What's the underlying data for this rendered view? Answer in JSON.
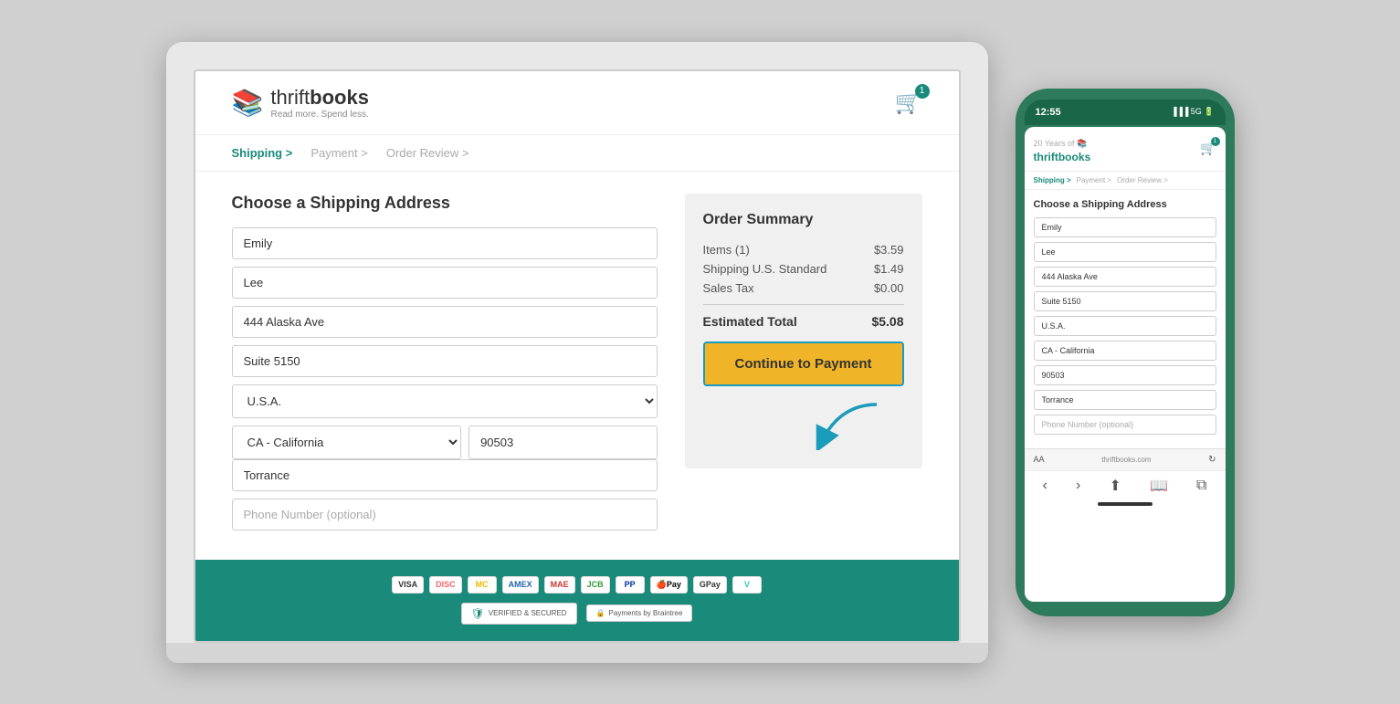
{
  "site": {
    "logo_text_light": "thrift",
    "logo_text_bold": "books",
    "logo_tagline": "Read more. Spend less.",
    "logo_icon": "📚"
  },
  "header": {
    "cart_count": "1"
  },
  "breadcrumbs": [
    {
      "label": "Shipping >",
      "active": true
    },
    {
      "label": "Payment >",
      "active": false
    },
    {
      "label": "Order Review >",
      "active": false
    }
  ],
  "shipping_form": {
    "title": "Choose a Shipping Address",
    "fields": {
      "first_name": "Emily",
      "last_name": "Lee",
      "address": "444 Alaska Ave",
      "suite": "Suite 5150",
      "country": "U.S.A.",
      "state": "CA - California",
      "zip": "90503",
      "city": "Torrance",
      "phone_placeholder": "Phone Number (optional)"
    }
  },
  "order_summary": {
    "title": "Order Summary",
    "items_label": "Items (1)",
    "items_price": "$3.59",
    "shipping_label": "Shipping U.S. Standard",
    "shipping_price": "$1.49",
    "tax_label": "Sales Tax",
    "tax_price": "$0.00",
    "total_label": "Estimated Total",
    "total_price": "$5.08",
    "cta_label": "Continue to Payment"
  },
  "payment_icons": [
    "VISA",
    "DISC",
    "MC",
    "AMEX",
    "MAE",
    "JCB",
    "PP",
    "ApplePay",
    "GPay",
    "Venmo"
  ],
  "security": {
    "verified": "VERIFIED & SECURED",
    "braintree": "Payments by Braintree"
  },
  "mobile": {
    "time": "12:55",
    "status": "📶 5G🔋",
    "breadcrumbs": [
      {
        "label": "Shipping >",
        "active": true
      },
      {
        "label": "Payment >",
        "active": false
      },
      {
        "label": "Order Review >",
        "active": false
      }
    ],
    "form_title": "Choose a Shipping Address",
    "fields": {
      "first_name": "Emily",
      "last_name": "Lee",
      "address": "444 Alaska Ave",
      "suite": "Suite 5150",
      "country": "U.S.A.",
      "state": "CA - California",
      "zip": "90503",
      "city": "Torrance",
      "phone_placeholder": "Phone Number (optional)"
    },
    "url": "thriftbooks.com"
  }
}
